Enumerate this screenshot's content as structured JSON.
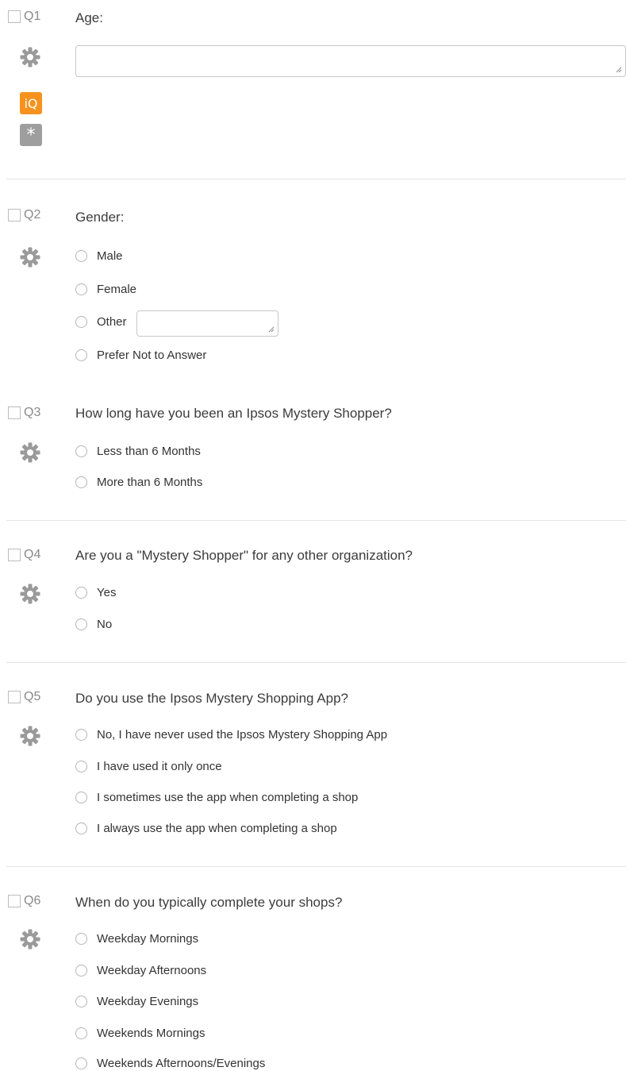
{
  "questions": [
    {
      "num": "Q1",
      "text": "Age:",
      "icons": [
        "gear-icon",
        "iq-icon",
        "required-icon"
      ],
      "iq_label": "iQ",
      "req_label": "*",
      "choices": []
    },
    {
      "num": "Q2",
      "text": "Gender:",
      "choices": [
        "Male",
        "Female",
        "Other",
        "Prefer Not to Answer"
      ]
    },
    {
      "num": "Q3",
      "text": "How long have you been an Ipsos Mystery Shopper?",
      "choices": [
        "Less than 6 Months",
        "More than 6 Months"
      ]
    },
    {
      "num": "Q4",
      "text": "Are you a \"Mystery Shopper\" for any other organization?",
      "choices": [
        "Yes",
        "No"
      ]
    },
    {
      "num": "Q5",
      "text": "Do you use the Ipsos Mystery Shopping App?",
      "choices": [
        "No, I have never used the Ipsos Mystery Shopping App",
        "I have used it only once",
        "I sometimes use the app when completing a shop",
        "I always use the app when completing a shop"
      ]
    },
    {
      "num": "Q6",
      "text": "When do you typically complete your shops?",
      "choices": [
        "Weekday Mornings",
        "Weekday Afternoons",
        "Weekday Evenings",
        "Weekends Mornings",
        "Weekends Afternoons/Evenings"
      ]
    }
  ],
  "colors": {
    "iq_badge": "#f7921e",
    "required_badge": "#9e9e9e",
    "gear": "#9a9a9a",
    "separator": "#e4e4e4"
  }
}
